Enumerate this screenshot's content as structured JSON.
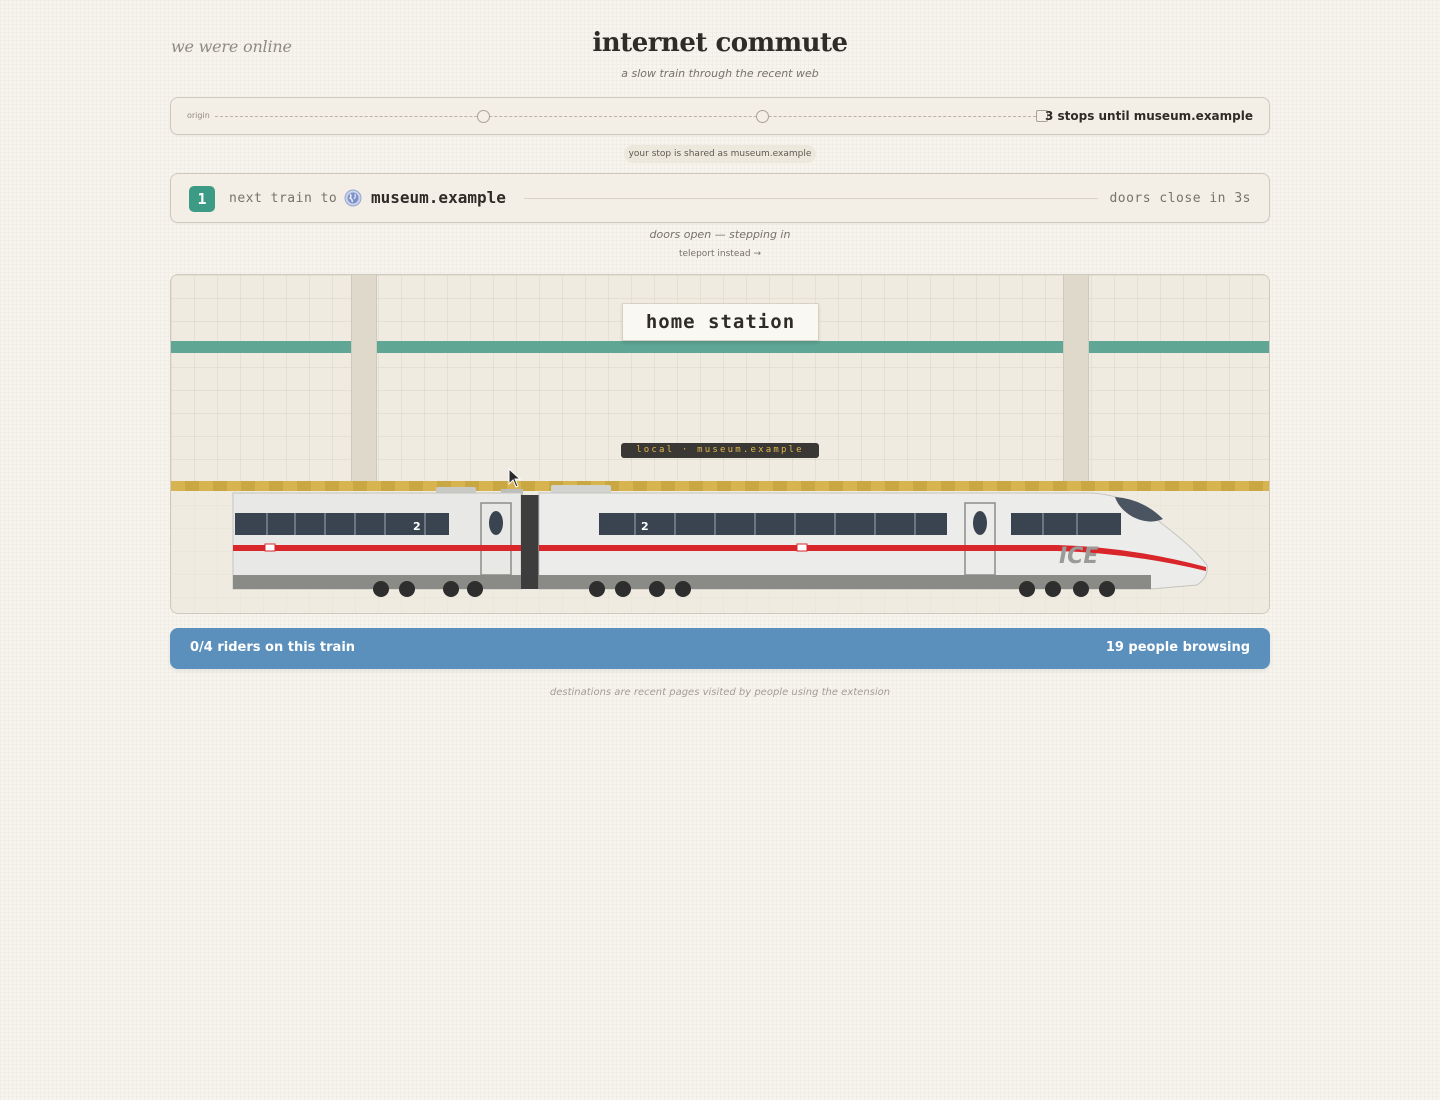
{
  "header": {
    "brand": "we were online",
    "title": "internet commute",
    "subtitle": "a slow train through the recent web"
  },
  "route": {
    "origin_label": "origin",
    "stops_label": "3 stops until museum.example"
  },
  "share_notice": "your stop is shared as museum.example",
  "next_train": {
    "number": "1",
    "lead": "next train to",
    "destination": "museum.example",
    "doors_label": "doors close in 3s"
  },
  "status": "doors open — stepping in",
  "teleport_link": "teleport instead →",
  "station": {
    "name": "home station",
    "route_sign": "local · museum.example",
    "train_logo": "ICE",
    "car_class_1": "2",
    "car_class_2": "2"
  },
  "riders": {
    "count_label": "0/4 riders on this train",
    "browsing_label": "19 people browsing"
  },
  "footer": "destinations are recent pages visited by people using the extension",
  "colors": {
    "accent_green": "#3d9b85",
    "stripe_teal": "#5fa695",
    "riders_blue": "#5b8fbc",
    "platform_yellow": "#d7b44f",
    "train_red": "#d8262b"
  }
}
